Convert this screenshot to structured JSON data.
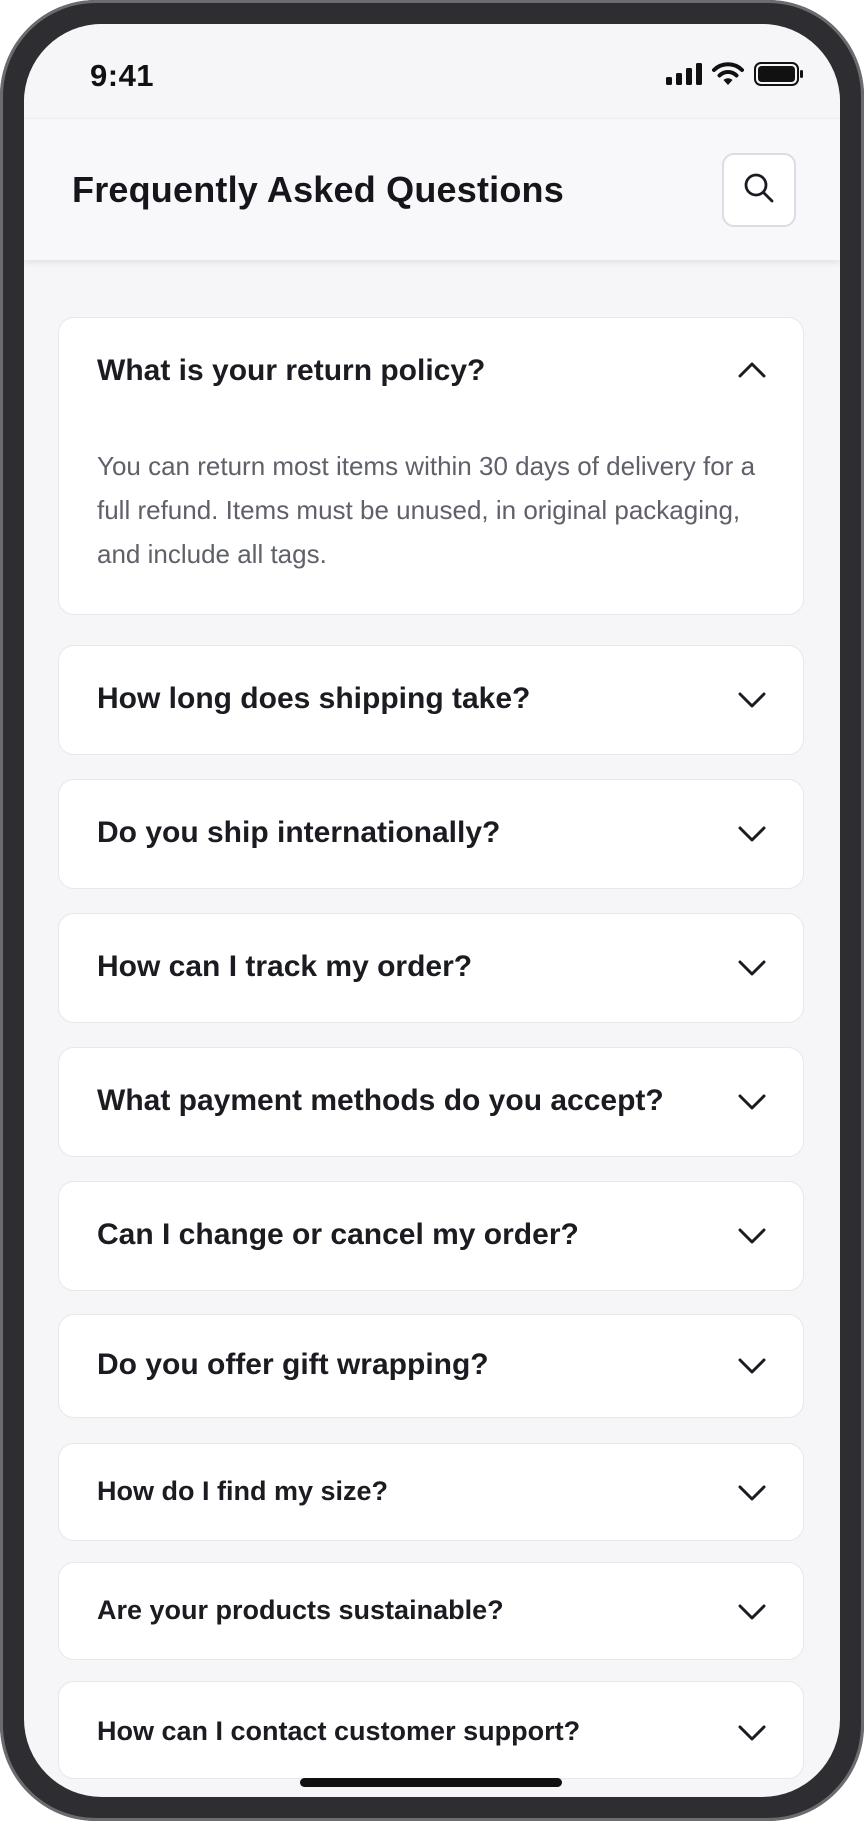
{
  "status_bar": {
    "time": "9:41",
    "icons": [
      "signal-icon",
      "wifi-icon",
      "battery-icon"
    ]
  },
  "header": {
    "title": "Frequently Asked Questions",
    "search_icon": "search-icon"
  },
  "faq": {
    "items": [
      {
        "question": "What is your return policy?",
        "answer": "You can return most items within 30 days of delivery for a full refund. Items must be unused, in original packaging, and include all tags.",
        "expanded": true
      },
      {
        "question": "How long does shipping take?",
        "expanded": false
      },
      {
        "question": "Do you ship internationally?",
        "expanded": false
      },
      {
        "question": "How can I track my order?",
        "expanded": false
      },
      {
        "question": "What payment methods do you accept?",
        "expanded": false
      },
      {
        "question": "Can I change or cancel my order?",
        "expanded": false
      },
      {
        "question": "Do you offer gift wrapping?",
        "expanded": false
      },
      {
        "question": "How do I find my size?",
        "expanded": false
      },
      {
        "question": "Are your products sustainable?",
        "expanded": false
      },
      {
        "question": "How can I contact customer support?",
        "expanded": false
      }
    ]
  },
  "colors": {
    "background": "#f6f6f8",
    "card": "#ffffff",
    "text_primary": "#1b1c22",
    "text_secondary": "#5f616a",
    "border": "#e7e7ec"
  }
}
